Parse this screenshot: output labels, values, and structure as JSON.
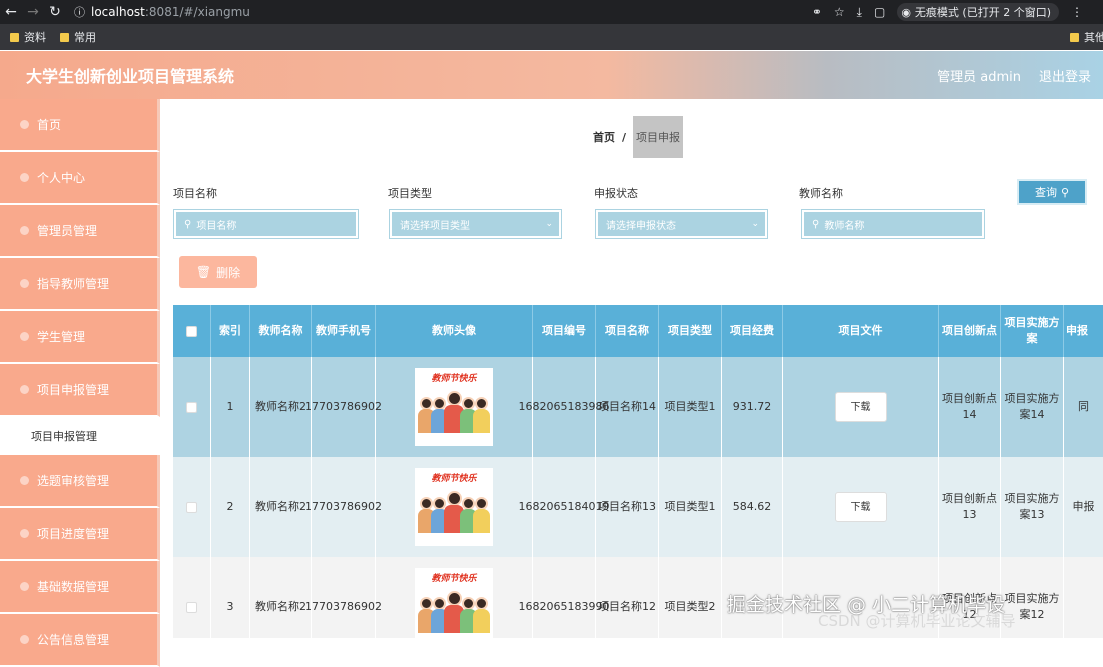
{
  "browser": {
    "url_host": "localhost",
    "url_path": ":8081/#/xiangmu",
    "incognito_label": "无痕模式 (已打开 2 个窗口)",
    "bookmarks": [
      "资料",
      "常用"
    ],
    "bookmark_other": "其他书"
  },
  "header": {
    "title": "大学生创新创业项目管理系统",
    "user": "管理员 admin",
    "logout": "退出登录"
  },
  "sidebar": {
    "items": [
      {
        "label": "首页"
      },
      {
        "label": "个人中心"
      },
      {
        "label": "管理员管理"
      },
      {
        "label": "指导教师管理"
      },
      {
        "label": "学生管理"
      },
      {
        "label": "项目申报管理"
      }
    ],
    "submenu": "项目申报管理",
    "items_after": [
      {
        "label": "选题审核管理"
      },
      {
        "label": "项目进度管理"
      },
      {
        "label": "基础数据管理"
      },
      {
        "label": "公告信息管理"
      }
    ]
  },
  "breadcrumb": {
    "home": "首页",
    "sep": "/",
    "current": "项目申报"
  },
  "filters": {
    "name": {
      "label": "项目名称",
      "placeholder": "项目名称"
    },
    "type": {
      "label": "项目类型",
      "placeholder": "请选择项目类型"
    },
    "status": {
      "label": "申报状态",
      "placeholder": "请选择申报状态"
    },
    "teacher": {
      "label": "教师名称",
      "placeholder": "教师名称"
    },
    "search_label": "查询"
  },
  "delete_label": "删除",
  "table": {
    "columns": [
      "",
      "索引",
      "教师名称",
      "教师手机号",
      "教师头像",
      "项目编号",
      "项目名称",
      "项目类型",
      "项目经费",
      "项目文件",
      "项目创新点",
      "项目实施方案",
      "申报"
    ],
    "avatar_text": "教师节快乐",
    "download_label": "下载",
    "rows": [
      {
        "idx": "1",
        "teacher": "教师名称2",
        "phone": "17703786902",
        "code": "1682065183986",
        "name": "项目名称14",
        "type": "项目类型1",
        "fund": "931.72",
        "innov": "项目创新点14",
        "plan": "项目实施方案14",
        "status": "同"
      },
      {
        "idx": "2",
        "teacher": "教师名称2",
        "phone": "17703786902",
        "code": "1682065184019",
        "name": "项目名称13",
        "type": "项目类型1",
        "fund": "584.62",
        "innov": "项目创新点13",
        "plan": "项目实施方案13",
        "status": "申报"
      },
      {
        "idx": "3",
        "teacher": "教师名称2",
        "phone": "17703786902",
        "code": "1682065183990",
        "name": "项目名称12",
        "type": "项目类型2",
        "fund": "",
        "innov": "项目创新点12",
        "plan": "项目实施方案12",
        "status": ""
      }
    ]
  },
  "watermark": {
    "line1": "掘金技术社区 @ 小二计算机毕设",
    "line2": "CSDN @计算机毕业论文辅导"
  }
}
